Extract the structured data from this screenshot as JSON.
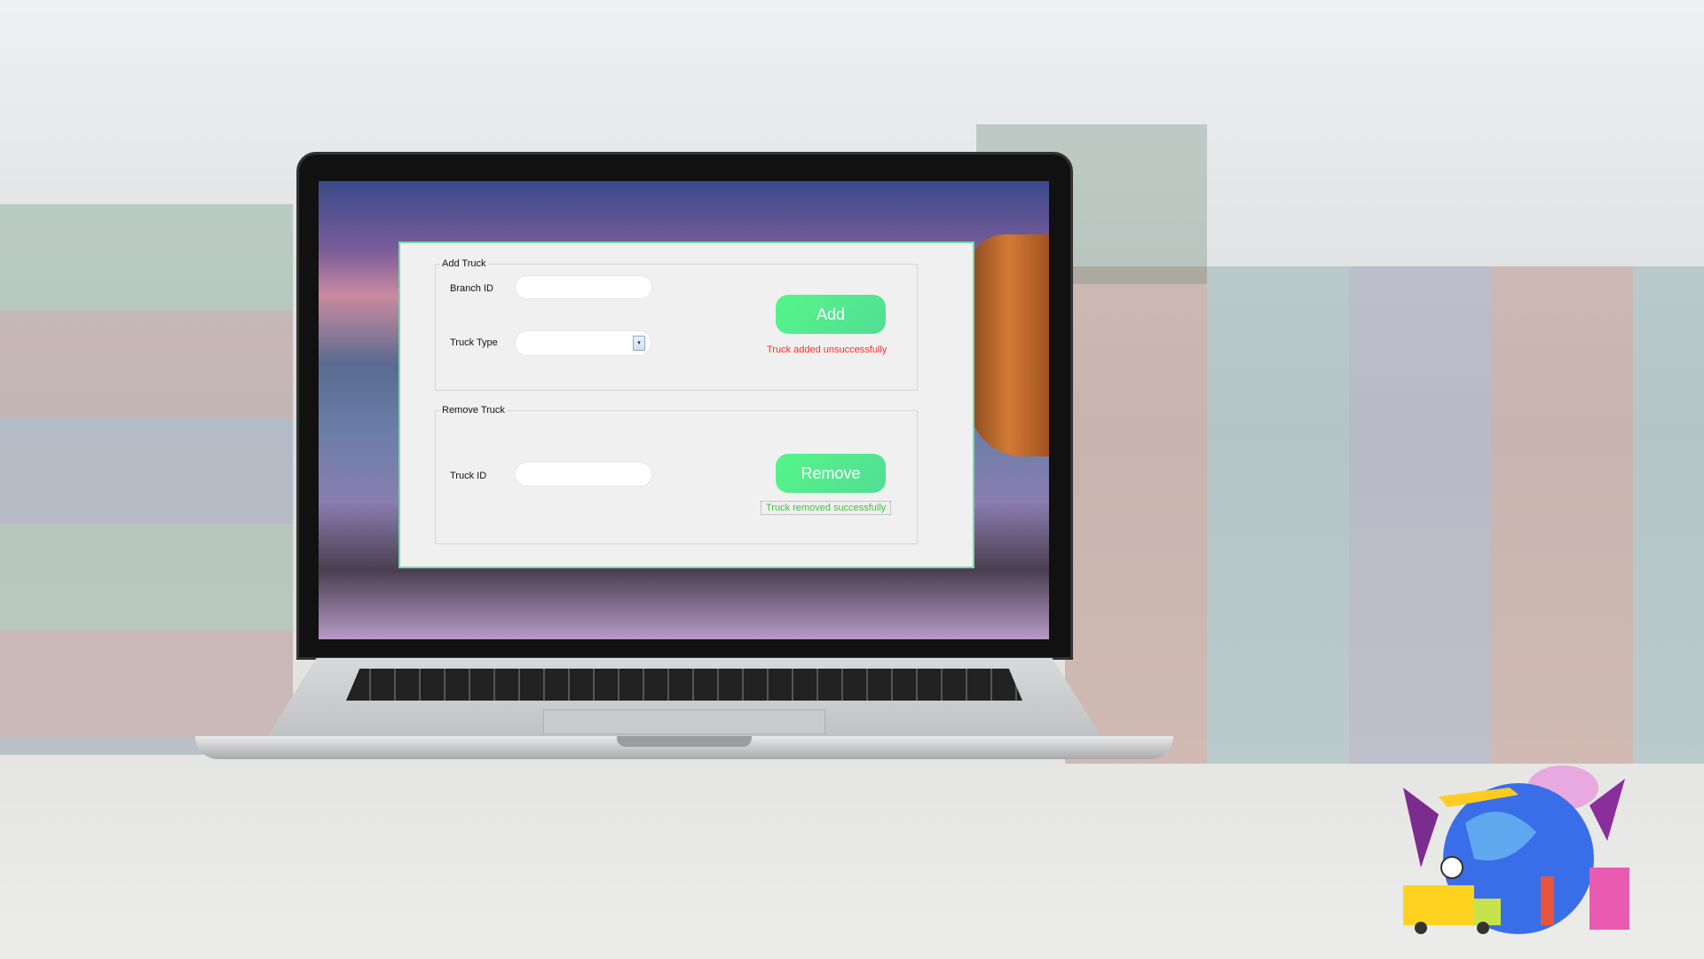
{
  "add_truck": {
    "legend": "Add Truck",
    "branch_id_label": "Branch ID",
    "branch_id_value": "",
    "truck_type_label": "Truck Type",
    "truck_type_value": "",
    "dropdown_icon": "▾",
    "add_button": "Add",
    "status": "Truck added unsuccessfully",
    "status_color": "#ff2a2a"
  },
  "remove_truck": {
    "legend": "Remove Truck",
    "truck_id_label": "Truck ID",
    "truck_id_value": "",
    "remove_button": "Remove",
    "status": "Truck removed successfully",
    "status_color": "#3cc43c"
  },
  "colors": {
    "accent": "#52f08c",
    "panel": "#f0f0f0"
  }
}
